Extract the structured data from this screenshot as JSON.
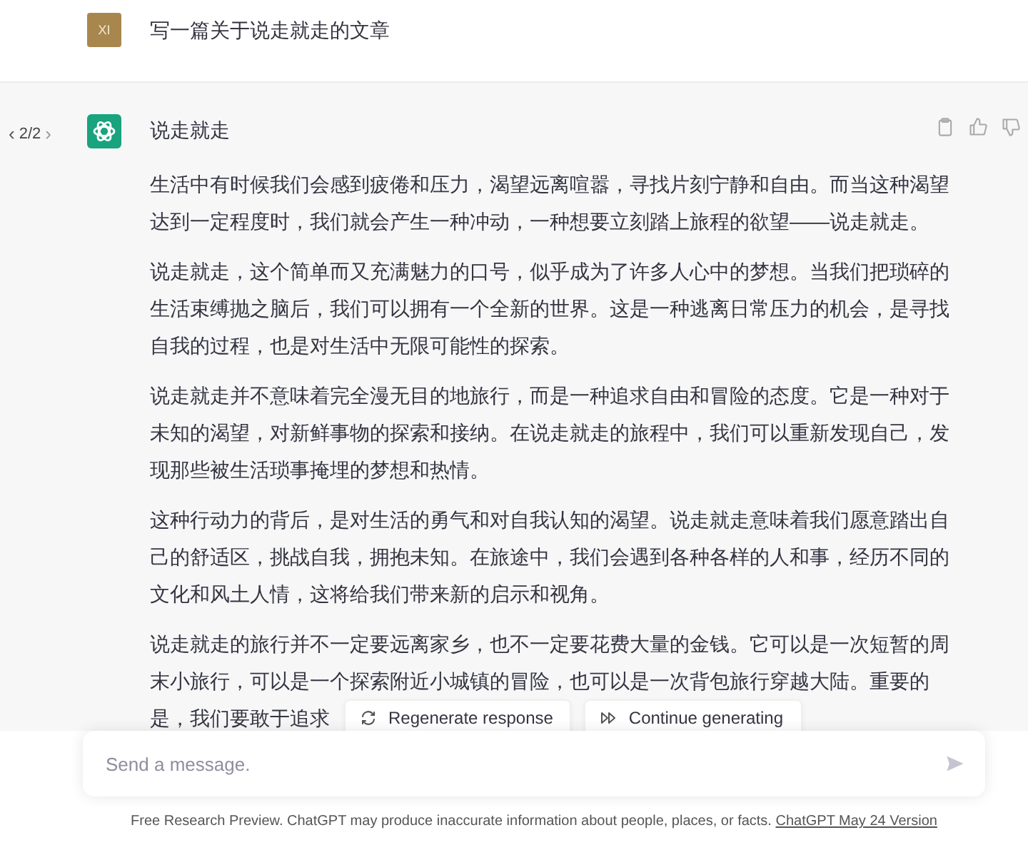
{
  "user_message": {
    "avatar": "XI",
    "text": "写一篇关于说走就走的文章"
  },
  "assistant_message": {
    "pager": {
      "prev": "‹",
      "label": "2/2",
      "next": "›",
      "prev_disabled": false,
      "next_disabled": true
    },
    "title": "说走就走",
    "paragraphs": [
      "生活中有时候我们会感到疲倦和压力，渴望远离喧嚣，寻找片刻宁静和自由。而当这种渴望达到一定程度时，我们就会产生一种冲动，一种想要立刻踏上旅程的欲望——说走就走。",
      "说走就走，这个简单而又充满魅力的口号，似乎成为了许多人心中的梦想。当我们把琐碎的生活束缚抛之脑后，我们可以拥有一个全新的世界。这是一种逃离日常压力的机会，是寻找自我的过程，也是对生活中无限可能性的探索。",
      "说走就走并不意味着完全漫无目的地旅行，而是一种追求自由和冒险的态度。它是一种对于未知的渴望，对新鲜事物的探索和接纳。在说走就走的旅程中，我们可以重新发现自己，发现那些被生活琐事掩埋的梦想和热情。",
      "这种行动力的背后，是对生活的勇气和对自我认知的渴望。说走就走意味着我们愿意踏出自己的舒适区，挑战自我，拥抱未知。在旅途中，我们会遇到各种各样的人和事，经历不同的文化和风土人情，这将给我们带来新的启示和视角。",
      "说走就走的旅行并不一定要远离家乡，也不一定要花费大量的金钱。它可以是一次短暂的周末小旅行，可以是一个探索附近小城镇的冒险，也可以是一次背包旅行穿越大陆。重要的"
    ],
    "paragraph_tail": "是，我们要敢于追求"
  },
  "actions": [
    {
      "kind": "regenerate",
      "label": "Regenerate response"
    },
    {
      "kind": "continue",
      "label": "Continue generating"
    }
  ],
  "composer": {
    "placeholder": "Send a message."
  },
  "footer": {
    "text": "Free Research Preview. ChatGPT may produce inaccurate information about people, places, or facts.",
    "link": "ChatGPT May 24 Version"
  }
}
